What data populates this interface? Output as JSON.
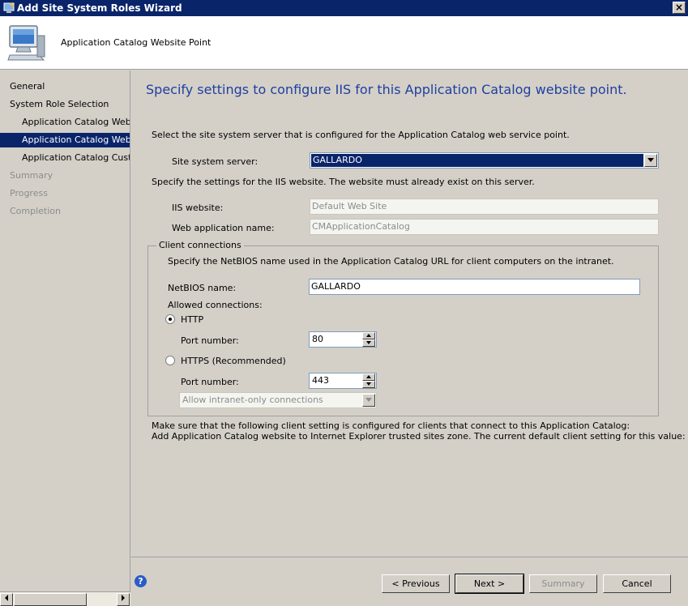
{
  "window": {
    "title": "Add Site System Roles Wizard",
    "close_glyph": "×"
  },
  "header": {
    "title": "Application Catalog Website Point"
  },
  "nav": {
    "items": [
      {
        "label": "General"
      },
      {
        "label": "System Role Selection"
      },
      {
        "label": "Application Catalog Web Se"
      },
      {
        "label": "Application Catalog Website"
      },
      {
        "label": "Application Catalog Customi"
      },
      {
        "label": "Summary"
      },
      {
        "label": "Progress"
      },
      {
        "label": "Completion"
      }
    ]
  },
  "content": {
    "heading": "Specify settings to configure IIS for this Application Catalog website point.",
    "intro": "Select the site system server that is configured for the Application Catalog web service point.",
    "site_server_label": "Site system server:",
    "site_server_value": "GALLARDO",
    "iis_intro": "Specify the settings for the IIS website. The website must already exist on this server.",
    "iis_website_label": "IIS website:",
    "iis_website_value": "Default Web Site",
    "web_app_label": "Web application name:",
    "web_app_value": "CMApplicationCatalog",
    "client_connections": {
      "legend": "Client connections",
      "desc": "Specify the NetBIOS name used in the Application Catalog URL for client computers on the intranet.",
      "netbios_label": "NetBIOS name:",
      "netbios_value": "GALLARDO",
      "allowed_label": "Allowed connections:",
      "http_label": "HTTP",
      "http_port_label": "Port number:",
      "http_port_value": "80",
      "https_label": "HTTPS (Recommended)",
      "https_port_label": "Port number:",
      "https_port_value": "443",
      "intranet_option": "Allow intranet-only connections"
    },
    "note_line1": "Make sure that the following client setting is configured for clients that connect to this Application Catalog:",
    "note_line2": "Add Application Catalog website to Internet Explorer trusted sites zone. The current default client setting for this value: False"
  },
  "footer": {
    "help_glyph": "?",
    "previous": "< Previous",
    "next": "Next >",
    "summary": "Summary",
    "cancel": "Cancel"
  }
}
